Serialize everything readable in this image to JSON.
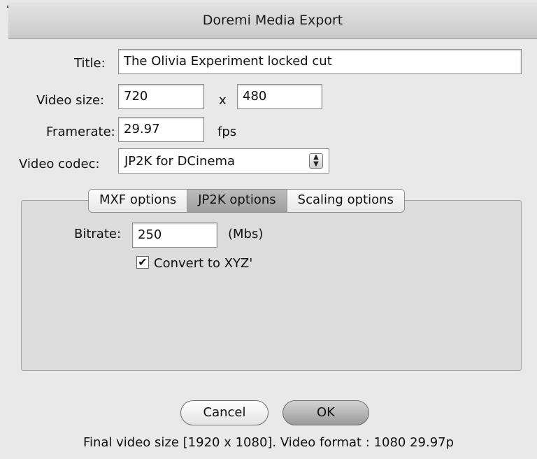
{
  "window": {
    "title": "Doremi Media Export"
  },
  "form": {
    "title_label": "Title:",
    "title_value": "The Olivia Experiment locked cut",
    "video_size_label": "Video size:",
    "width_value": "720",
    "x_label": "x",
    "height_value": "480",
    "framerate_label": "Framerate:",
    "framerate_value": "29.97",
    "fps_label": "fps",
    "codec_label": "Video codec:",
    "codec_value": "JP2K for DCinema"
  },
  "tabs": [
    {
      "label": "MXF options",
      "active": false
    },
    {
      "label": "JP2K options",
      "active": true
    },
    {
      "label": "Scaling options",
      "active": false
    }
  ],
  "jp2k": {
    "bitrate_label": "Bitrate:",
    "bitrate_value": "250",
    "bitrate_unit": "(Mbs)",
    "convert_label": "Convert to XYZ'",
    "convert_checked": true
  },
  "buttons": {
    "cancel": "Cancel",
    "ok": "OK"
  },
  "status": "Final video size [1920 x 1080]. Video format : 1080 29.97p",
  "icons": {
    "select_arrow": "updown-arrows-icon",
    "check": "checkmark-icon"
  }
}
